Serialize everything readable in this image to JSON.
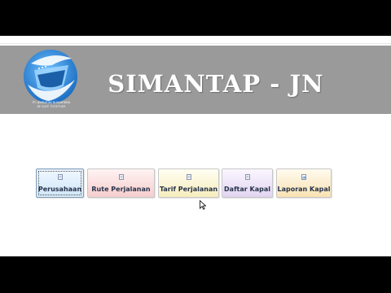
{
  "app": {
    "title": "SIMANTAP - JN",
    "logo": {
      "company_name": "PT. JEMBATAN NUSANTARA",
      "subtitle": "BE SAFE TOGETHER"
    }
  },
  "menu": {
    "buttons": [
      {
        "label": "Perusahaan",
        "icon": "document-icon",
        "focused": true
      },
      {
        "label": "Rute Perjalanan",
        "icon": "document-icon"
      },
      {
        "label": "Tarif Perjalanan",
        "icon": "document-icon"
      },
      {
        "label": "Daftar Kapal",
        "icon": "document-icon"
      },
      {
        "label": "Laporan Kapal",
        "icon": "report-icon"
      }
    ]
  },
  "colors": {
    "header_band": "#999a99",
    "title_text": "#ffffff",
    "logo_blue": "#2f8fdd"
  }
}
